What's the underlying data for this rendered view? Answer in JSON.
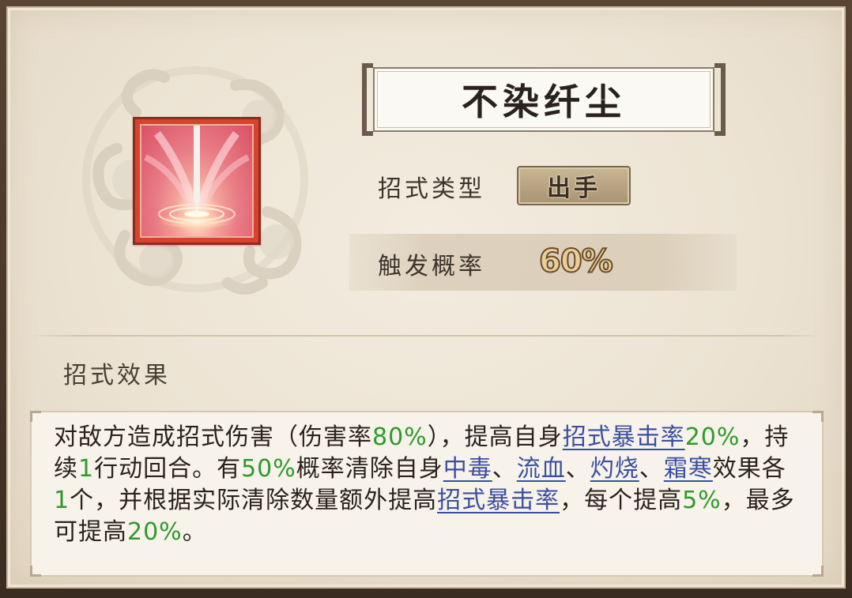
{
  "skill": {
    "name": "不染纤尘",
    "type_label": "招式类型",
    "type_value": "出手",
    "rate_label": "触发概率",
    "rate_value": "60%"
  },
  "effect": {
    "section_title": "招式效果",
    "segments": [
      {
        "t": "对敌方造成招式伤害（伤害率"
      },
      {
        "t": "80%",
        "g": 1
      },
      {
        "t": "），提高自身"
      },
      {
        "t": "招式暴击率",
        "l": 1
      },
      {
        "t": "20%",
        "g": 1
      },
      {
        "t": "，持续"
      },
      {
        "t": "1",
        "g": 1
      },
      {
        "t": "行动回合。有"
      },
      {
        "t": "50%",
        "g": 1
      },
      {
        "t": "概率清除自身"
      },
      {
        "t": "中毒",
        "l": 1
      },
      {
        "t": "、"
      },
      {
        "t": "流血",
        "l": 1
      },
      {
        "t": "、"
      },
      {
        "t": "灼烧",
        "l": 1
      },
      {
        "t": "、"
      },
      {
        "t": "霜寒",
        "l": 1
      },
      {
        "t": "效果各"
      },
      {
        "t": "1",
        "g": 1
      },
      {
        "t": "个，并根据实际清除数量额外提高"
      },
      {
        "t": "招式暴击率",
        "l": 1
      },
      {
        "t": "，每个提高"
      },
      {
        "t": "5%",
        "g": 1
      },
      {
        "t": "，最多可提高"
      },
      {
        "t": "20%",
        "g": 1
      },
      {
        "t": "。"
      }
    ]
  },
  "colors": {
    "value_green": "#2f9a2b",
    "keyword_blue": "#3b4fa0",
    "icon_red": "#d8432f"
  },
  "icons": {
    "emblem": "cloud-swirl-emblem",
    "skill": "sword-ripple-icon"
  }
}
